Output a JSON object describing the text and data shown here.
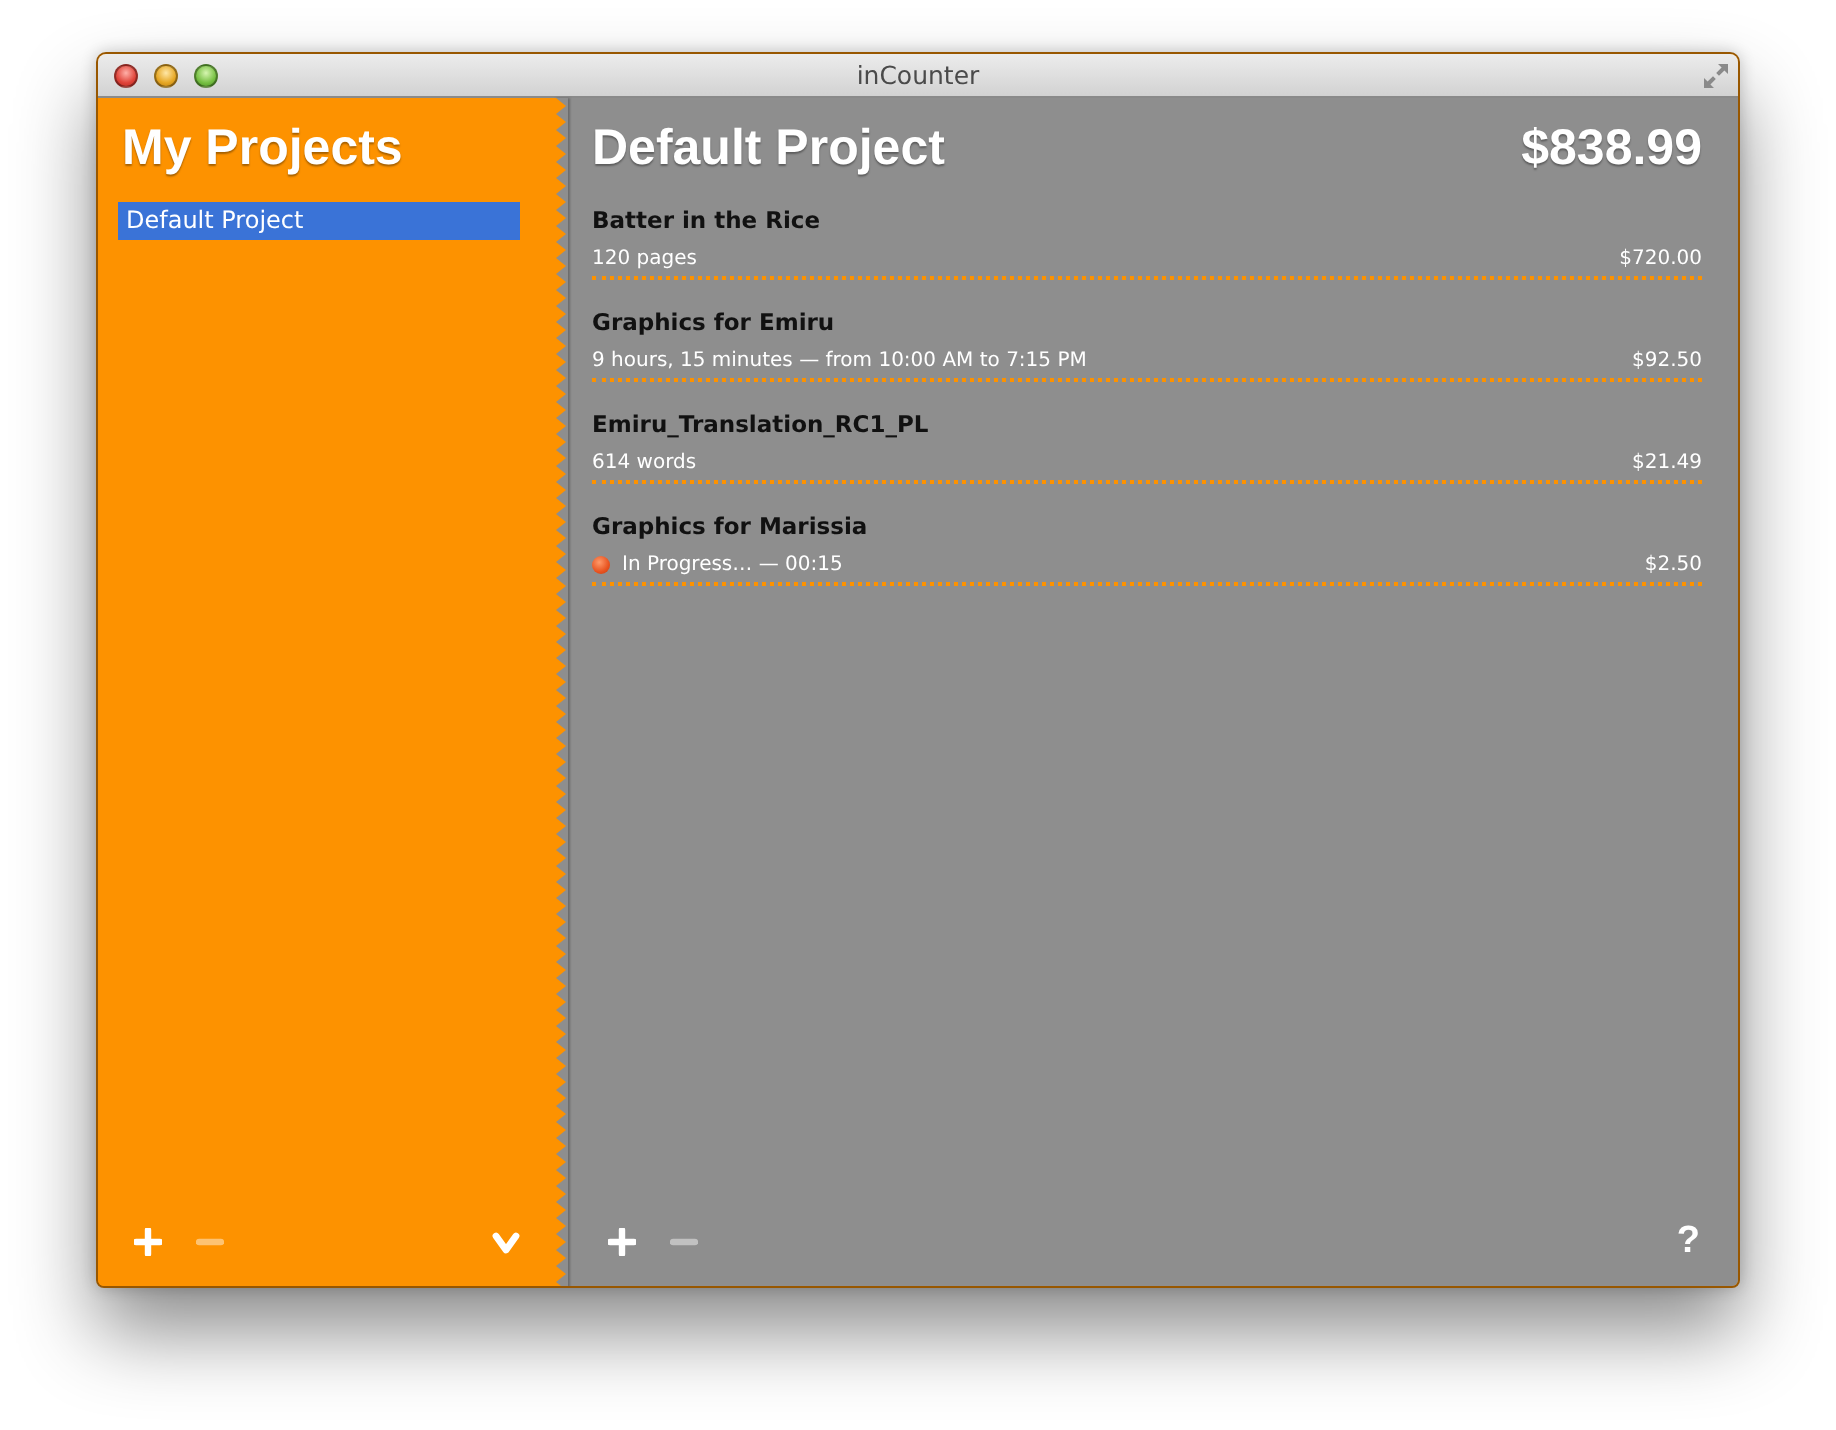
{
  "window": {
    "title": "inCounter"
  },
  "sidebar": {
    "title": "My Projects",
    "projects": [
      {
        "name": "Default Project",
        "selected": true
      }
    ],
    "toolbar": [
      {
        "kind": "add",
        "disabled": false
      },
      {
        "kind": "remove",
        "disabled": true
      },
      {
        "kind": "menu",
        "disabled": false
      }
    ]
  },
  "main": {
    "title": "Default Project",
    "total": "$838.99",
    "entries": [
      {
        "name": "Batter in the Rice",
        "detail": "120 pages",
        "amount": "$720.00",
        "in_progress": false
      },
      {
        "name": "Graphics for Emiru",
        "detail": "9 hours, 15 minutes — from 10:00 AM to 7:15 PM",
        "amount": "$92.50",
        "in_progress": false
      },
      {
        "name": "Emiru_Translation_RC1_PL",
        "detail": "614 words",
        "amount": "$21.49",
        "in_progress": false
      },
      {
        "name": "Graphics for Marissia",
        "detail": "In Progress… — 00:15",
        "amount": "$2.50",
        "in_progress": true
      }
    ],
    "toolbar": [
      {
        "kind": "add",
        "disabled": false
      },
      {
        "kind": "remove",
        "disabled": true
      },
      {
        "kind": "help",
        "label": "?",
        "disabled": false
      }
    ]
  }
}
